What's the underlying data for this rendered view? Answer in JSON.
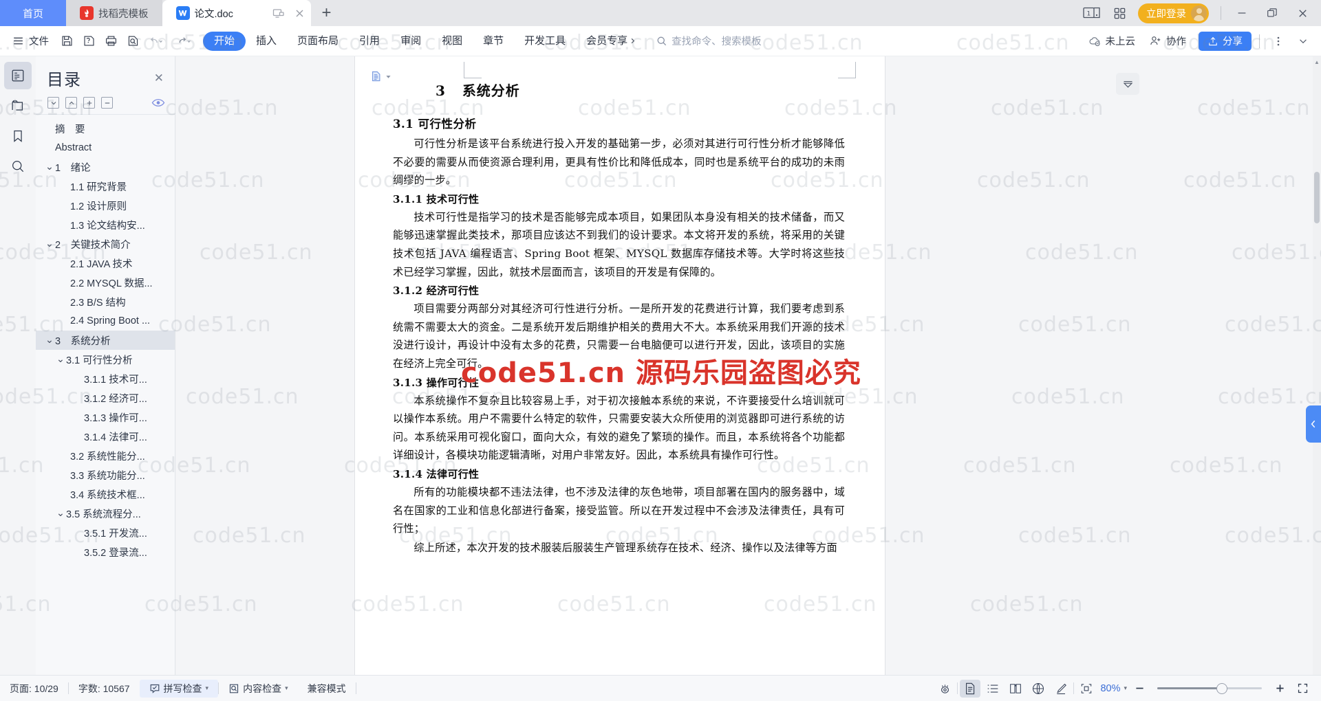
{
  "window": {
    "tabs": [
      {
        "label": "首页",
        "icon": "home-tab",
        "state": "home"
      },
      {
        "label": "找稻壳模板",
        "icon": "docer-icon",
        "state": "inactive"
      },
      {
        "label": "论文.doc",
        "icon": "wps-writer-icon",
        "state": "active"
      }
    ],
    "new_tab_label": "+",
    "tab_actions": [
      "screen-split-icon",
      "close-tab-icon"
    ],
    "right_buttons": [
      {
        "name": "single-page-view-icon",
        "label": "1"
      },
      {
        "name": "app-grid-icon",
        "label": ""
      }
    ],
    "login_label": "立即登录",
    "controls": {
      "minimize": "−",
      "maximize": "❐",
      "close": "✕"
    }
  },
  "ribbon": {
    "file_label": "文件",
    "quick_icons": [
      "save-icon",
      "save-as-icon",
      "print-icon",
      "print-preview-icon",
      "undo-icon",
      "undo-dropdown-icon",
      "redo-icon",
      "redo-dropdown-icon"
    ],
    "tabs": [
      {
        "label": "开始",
        "active": true
      },
      {
        "label": "插入",
        "active": false
      },
      {
        "label": "页面布局",
        "active": false
      },
      {
        "label": "引用",
        "active": false
      },
      {
        "label": "审阅",
        "active": false
      },
      {
        "label": "视图",
        "active": false
      },
      {
        "label": "章节",
        "active": false
      },
      {
        "label": "开发工具",
        "active": false
      },
      {
        "label": "会员专享",
        "active": false
      }
    ],
    "search_placeholder": "查找命令、搜索模板",
    "cloud_status": "未上云",
    "collab_label": "协作",
    "share_label": "分享",
    "more_label": "⋮"
  },
  "rail": {
    "items": [
      {
        "name": "outline-panel-icon",
        "label": "目录",
        "active": true
      },
      {
        "name": "thumbnail-panel-icon",
        "label": "章节导航",
        "active": false
      },
      {
        "name": "bookmark-panel-icon",
        "label": "书签",
        "active": false
      },
      {
        "name": "search-panel-icon",
        "label": "查找替换",
        "active": false
      }
    ]
  },
  "outline": {
    "title": "目录",
    "close_label": "✕",
    "tools": [
      {
        "name": "expand-down-button",
        "glyph": "⌄"
      },
      {
        "name": "collapse-up-button",
        "glyph": "⌃"
      },
      {
        "name": "expand-all-button",
        "glyph": "+"
      },
      {
        "name": "collapse-all-button",
        "glyph": "−"
      }
    ],
    "eye_icon": "outline-visibility-icon",
    "items": [
      {
        "label": "摘　要",
        "level": 0,
        "caret": "",
        "selected": false
      },
      {
        "label": "Abstract",
        "level": 0,
        "caret": "",
        "selected": false
      },
      {
        "label": "1　绪论",
        "level": 1,
        "caret": "⌄",
        "selected": false
      },
      {
        "label": "1.1 研究背景",
        "level": 2,
        "caret": "",
        "selected": false
      },
      {
        "label": "1.2 设计原则",
        "level": 2,
        "caret": "",
        "selected": false
      },
      {
        "label": "1.3 论文结构安...",
        "level": 2,
        "caret": "",
        "selected": false
      },
      {
        "label": "2　关键技术简介",
        "level": 1,
        "caret": "⌄",
        "selected": false
      },
      {
        "label": "2.1 JAVA 技术",
        "level": 2,
        "caret": "",
        "selected": false
      },
      {
        "label": "2.2 MYSQL 数据...",
        "level": 2,
        "caret": "",
        "selected": false
      },
      {
        "label": "2.3 B/S 结构",
        "level": 2,
        "caret": "",
        "selected": false
      },
      {
        "label": "2.4 Spring Boot ...",
        "level": 2,
        "caret": "",
        "selected": false
      },
      {
        "label": "3　系统分析",
        "level": 1,
        "caret": "⌄",
        "selected": true
      },
      {
        "label": "3.1 可行性分析",
        "level": 2,
        "caret": "⌄",
        "selected": false
      },
      {
        "label": "3.1.1 技术可...",
        "level": 3,
        "caret": "",
        "selected": false
      },
      {
        "label": "3.1.2 经济可...",
        "level": 3,
        "caret": "",
        "selected": false
      },
      {
        "label": "3.1.3 操作可...",
        "level": 3,
        "caret": "",
        "selected": false
      },
      {
        "label": "3.1.4 法律可...",
        "level": 3,
        "caret": "",
        "selected": false
      },
      {
        "label": "3.2 系统性能分...",
        "level": 2,
        "caret": "",
        "selected": false
      },
      {
        "label": "3.3 系统功能分...",
        "level": 2,
        "caret": "",
        "selected": false
      },
      {
        "label": "3.4 系统技术框...",
        "level": 2,
        "caret": "",
        "selected": false
      },
      {
        "label": "3.5 系统流程分...",
        "level": 2,
        "caret": "⌄",
        "selected": false
      },
      {
        "label": "3.5.1 开发流...",
        "level": 3,
        "caret": "",
        "selected": false
      },
      {
        "label": "3.5.2 登录流...",
        "level": 3,
        "caret": "",
        "selected": false
      }
    ]
  },
  "document": {
    "heading1": {
      "number": "3",
      "text": "系统分析"
    },
    "blocks": [
      {
        "type": "h2",
        "number": "3.1",
        "text": "可行性分析"
      },
      {
        "type": "p",
        "text": "可行性分析是该平台系统进行投入开发的基础第一步，必须对其进行可行性分析才能够降低不必要的需要从而使资源合理利用，更具有性价比和降低成本，同时也是系统平台的成功的未雨绸缪的一步。"
      },
      {
        "type": "h3",
        "number": "3.1.1",
        "text": "技术可行性"
      },
      {
        "type": "p",
        "text": "技术可行性是指学习的技术是否能够完成本项目，如果团队本身没有相关的技术储备，而又能够迅速掌握此类技术，那项目应该达不到我们的设计要求。本文将开发的系统，将采用的关键技术包括 JAVA 编程语言、Spring Boot 框架、MYSQL 数据库存储技术等。大学时将这些技术已经学习掌握，因此，就技术层面而言，该项目的开发是有保障的。"
      },
      {
        "type": "h3",
        "number": "3.1.2",
        "text": "经济可行性"
      },
      {
        "type": "p",
        "text": "项目需要分两部分对其经济可行性进行分析。一是所开发的花费进行计算，我们要考虑到系统需不需要太大的资金。二是系统开发后期维护相关的费用大不大。本系统采用我们开源的技术没进行设计，再设计中没有太多的花费，只需要一台电脑便可以进行开发，因此，该项目的实施在经济上完全可行。"
      },
      {
        "type": "h3",
        "number": "3.1.3",
        "text": "操作可行性"
      },
      {
        "type": "p",
        "text": "本系统操作不复杂且比较容易上手，对于初次接触本系统的来说，不许要接受什么培训就可以操作本系统。用户不需要什么特定的软件，只需要安装大众所使用的浏览器即可进行系统的访问。本系统采用可视化窗口，面向大众，有效的避免了繁琐的操作。而且，本系统将各个功能都详细设计，各模块功能逻辑清晰，对用户非常友好。因此，本系统具有操作可行性。"
      },
      {
        "type": "h3",
        "number": "3.1.4",
        "text": "法律可行性"
      },
      {
        "type": "p",
        "text": "所有的功能模块都不违法法律，也不涉及法律的灰色地带，项目部署在国内的服务器中，域名在国家的工业和信息化部进行备案，接受监管。所以在开发过程中不会涉及法律责任，具有可行性；"
      },
      {
        "type": "p",
        "text": "综上所述，本次开发的技术服装后服装生产管理系统存在技术、经济、操作以及法律等方面"
      }
    ]
  },
  "floating": {
    "collapse_ribbon_icon": "collapse-ribbon-icon",
    "right_panel_toggle_icon": "right-panel-toggle-icon"
  },
  "status": {
    "page_label": "页面: 10/29",
    "word_count_label": "字数: 10567",
    "spellcheck_label": "拼写检查",
    "contentcheck_label": "内容检查",
    "compat_label": "兼容模式",
    "view_icons": [
      {
        "name": "reading-focus-icon",
        "active": false
      },
      {
        "name": "print-layout-icon",
        "active": true
      },
      {
        "name": "outline-view-icon",
        "active": false
      },
      {
        "name": "reading-view-icon",
        "active": false
      },
      {
        "name": "web-layout-icon",
        "active": false
      },
      {
        "name": "writing-mode-icon",
        "active": false
      }
    ],
    "fit_page_icon": "fit-page-icon",
    "zoom_label": "80%",
    "zoom_minus": "−",
    "zoom_plus": "+",
    "fullscreen_icon": "fullscreen-icon"
  },
  "watermark": {
    "text": "code51.cn",
    "banner": "code51.cn 源码乐园盗图必究"
  }
}
